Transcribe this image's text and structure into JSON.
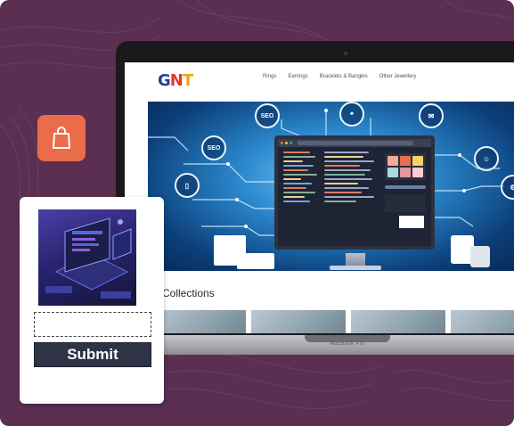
{
  "colors": {
    "background": "#5a2f52",
    "bag_button": "#ea6c48",
    "submit_button": "#2f3346"
  },
  "site": {
    "logo": {
      "g": "G",
      "n": "N",
      "t": "T"
    },
    "nav": [
      "Rings",
      "Earrings",
      "Bracelets & Bangles",
      "Other Jewellery"
    ],
    "hero_icons": [
      "SEO",
      "SEO"
    ],
    "collections_title": "w Collections"
  },
  "laptop": {
    "model_label": "MacBook Pro"
  },
  "bag_icon": "shopping-bag-icon",
  "form": {
    "input_value": "",
    "submit_label": "Submit"
  }
}
